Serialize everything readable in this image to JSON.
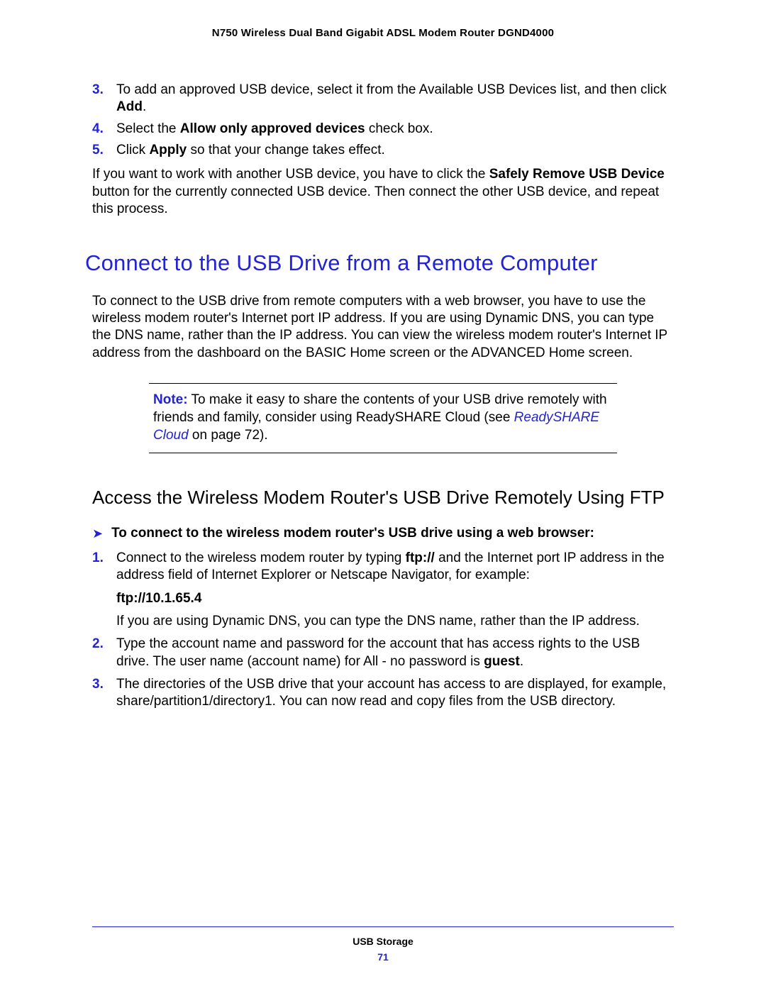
{
  "header": {
    "product_title": "N750 Wireless Dual Band Gigabit ADSL Modem Router DGND4000"
  },
  "steps_top": {
    "s3_num": "3.",
    "s3_a": "To add an approved USB device, select it from the Available USB Devices list, and then click ",
    "s3_b": "Add",
    "s3_c": ".",
    "s4_num": "4.",
    "s4_a": "Select the ",
    "s4_b": "Allow only approved devices",
    "s4_c": " check box.",
    "s5_num": "5.",
    "s5_a": "Click ",
    "s5_b": "Apply",
    "s5_c": " so that your change takes effect."
  },
  "para1": {
    "a": "If you want to work with another USB device, you have to click the ",
    "b": "Safely Remove USB Device",
    "c": " button for the currently connected USB device. Then connect the other USB device, and repeat this process."
  },
  "h1": "Connect to the USB Drive from a Remote Computer",
  "para2": "To connect to the USB drive from remote computers with a web browser, you have to use the wireless modem router's Internet port IP address. If you are using Dynamic DNS, you can type the DNS name, rather than the IP address. You can view the wireless modem router's Internet IP address from the dashboard on the BASIC Home screen or the ADVANCED Home screen.",
  "note": {
    "label": "Note:",
    "a": "  To make it easy to share the contents of your USB drive remotely with friends and family, consider using ReadySHARE Cloud (see ",
    "link": "ReadySHARE Cloud",
    "b": " on page 72)."
  },
  "h2": "Access the Wireless Modem Router's USB Drive Remotely Using FTP",
  "proc": {
    "lead": "To connect to the wireless modem router's USB drive using a web browser:",
    "s1_num": "1.",
    "s1_a": "Connect to the wireless modem router by typing ",
    "s1_b": "ftp://",
    "s1_c": " and the Internet port IP address in the address field of Internet Explorer or Netscape Navigator, for example:",
    "ftp_url": "ftp://10.1.65.4",
    "s1_d": "If you are using Dynamic DNS, you can type the DNS name, rather than the IP address.",
    "s2_num": "2.",
    "s2_a": "Type the account name and password for the account that has access rights to the USB drive. The user name (account name) for All - no password is ",
    "s2_b": "guest",
    "s2_c": ".",
    "s3_num": "3.",
    "s3_a": "The directories of the USB drive that your account has access to are displayed, for example, share/partition1/directory1. You can now read and copy files from the USB directory."
  },
  "footer": {
    "section": "USB Storage",
    "page": "71"
  }
}
